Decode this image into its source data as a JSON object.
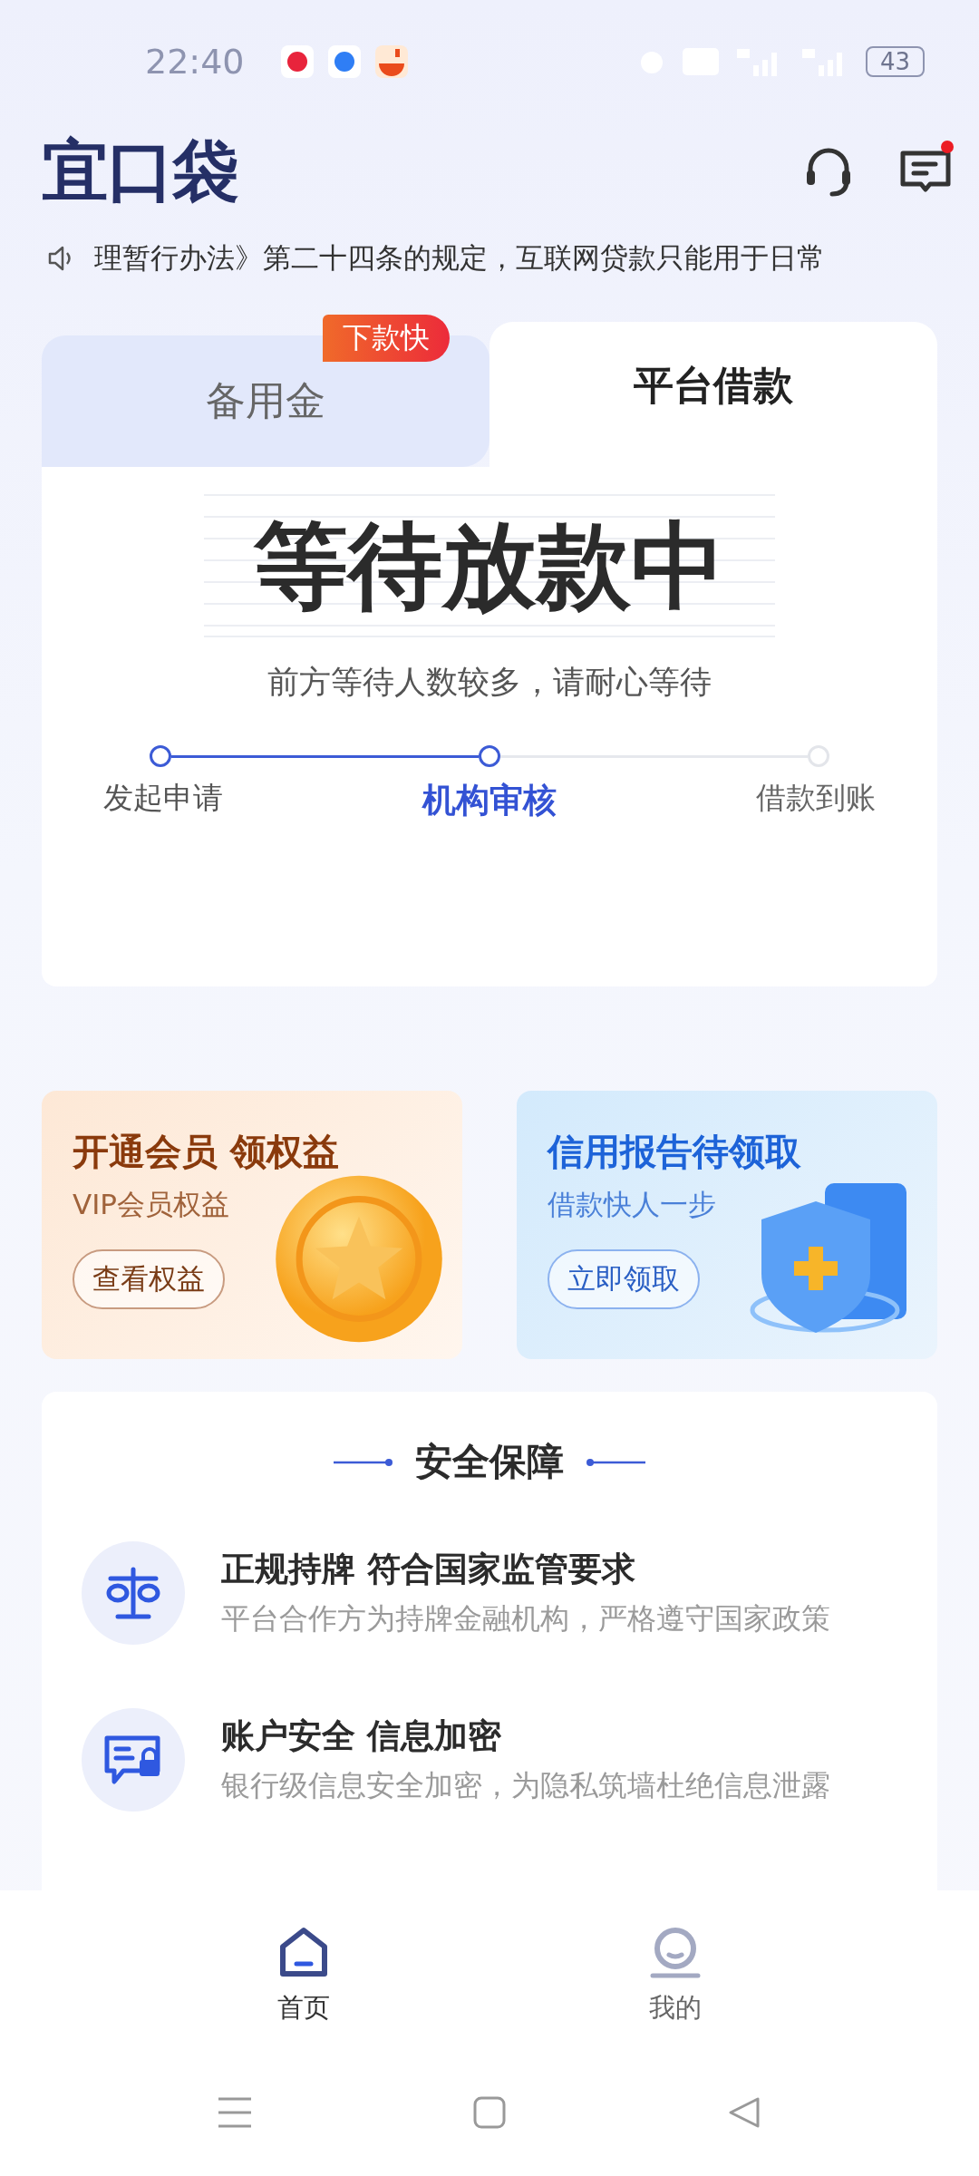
{
  "status_bar": {
    "time": "22:40",
    "battery": "43"
  },
  "header": {
    "logo": "宜口袋",
    "has_unread": true
  },
  "notice": {
    "text": "理暂行办法》第二十四条的规定，互联网贷款只能用于日常"
  },
  "tabs": [
    {
      "label": "备用金",
      "selected": false,
      "badge": "下款快"
    },
    {
      "label": "平台借款",
      "selected": true
    }
  ],
  "status": {
    "title": "等待放款中",
    "subtitle": "前方等待人数较多，请耐心等待"
  },
  "steps": [
    {
      "label": "发起申请",
      "kind": "done"
    },
    {
      "label": "机构审核",
      "kind": "current"
    },
    {
      "label": "借款到账",
      "kind": "pending"
    }
  ],
  "promos": [
    {
      "kind": "vip",
      "title": "开通会员 领权益",
      "subtitle": "VIP会员权益",
      "button": "查看权益"
    },
    {
      "kind": "credit",
      "title": "信用报告待领取",
      "subtitle": "借款快人一步",
      "button": "立即领取"
    }
  ],
  "safety": {
    "title": "安全保障",
    "items": [
      {
        "kind": "license",
        "title": "正规持牌 符合国家监管要求",
        "text": "平台合作方为持牌金融机构，严格遵守国家政策"
      },
      {
        "kind": "privacy",
        "title": "账户安全 信息加密",
        "text": "银行级信息安全加密，为隐私筑墙杜绝信息泄露"
      }
    ]
  },
  "bottom_nav": [
    {
      "label": "首页",
      "kind": "home",
      "selected": true
    },
    {
      "label": "我的",
      "kind": "profile",
      "selected": false
    }
  ]
}
